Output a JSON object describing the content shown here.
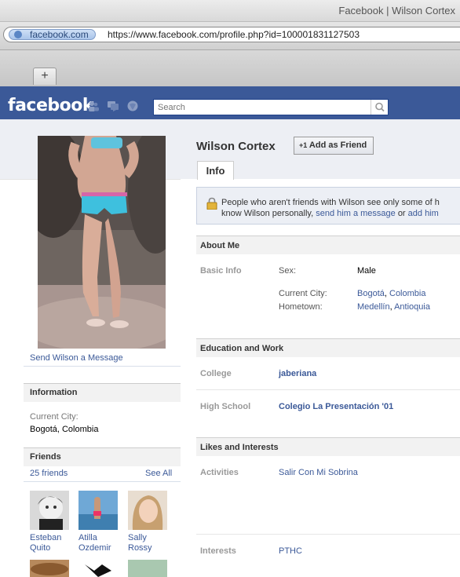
{
  "browser": {
    "window_title": "Facebook | Wilson Cortex",
    "site_identity": "facebook.com",
    "url": "https://www.facebook.com/profile.php?id=100001831127503",
    "new_tab_label": "+"
  },
  "header": {
    "logo_text": "facebook",
    "search_placeholder": "Search",
    "brand_color": "#3b5998",
    "icons": [
      "friends-icon",
      "messages-icon",
      "notifications-icon",
      "magnifier-icon"
    ]
  },
  "profile": {
    "name": "Wilson Cortex",
    "add_friend_label": "Add as Friend",
    "add_friend_prefix": "+1",
    "send_message_link": "Send Wilson a Message"
  },
  "tabs": [
    {
      "label": "Info"
    }
  ],
  "notice": {
    "line1": "People who aren't friends with Wilson see only some of h",
    "line2_prefix": "know Wilson personally,",
    "line2_link1": "send him a message",
    "line2_mid": "or",
    "line2_link2": "add him"
  },
  "sidebar": {
    "information_header": "Information",
    "current_city_label": "Current City:",
    "current_city_value": "Bogotá, Colombia",
    "friends_header": "Friends",
    "friends_count": "25 friends",
    "see_all": "See All",
    "friends": [
      {
        "first": "Esteban",
        "last": "Quito"
      },
      {
        "first": "Atilla",
        "last": "Ozdemir"
      },
      {
        "first": "Sally",
        "last": "Rossy"
      }
    ]
  },
  "about": {
    "header": "About Me",
    "basic_info_label": "Basic Info",
    "sex_label": "Sex:",
    "sex_value": "Male",
    "current_city_label": "Current City:",
    "current_city_value": "Bogotá, Colombia",
    "current_city_part1": "Bogotá",
    "current_city_part2": "Colombia",
    "hometown_label": "Hometown:",
    "hometown_part1": "Medellín",
    "hometown_part2": "Antioquia"
  },
  "education": {
    "header": "Education and Work",
    "college_label": "College",
    "college_value": "jaberiana",
    "high_school_label": "High School",
    "high_school_value": "Colegio La Presentación '01"
  },
  "likes": {
    "header": "Likes and Interests",
    "activities_label": "Activities",
    "activities_value": "Salir Con Mi Sobrina",
    "interests_label": "Interests",
    "interests_value": "PTHC"
  }
}
